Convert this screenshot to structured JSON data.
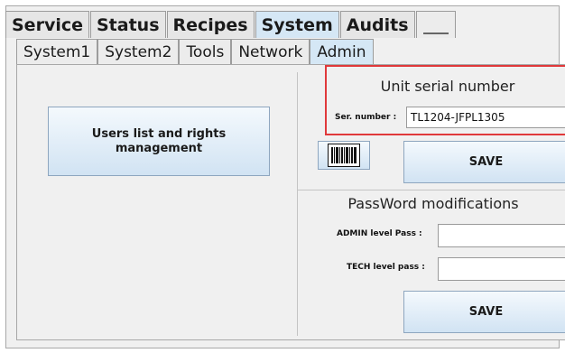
{
  "main_tabs": [
    {
      "label": "Service",
      "active": false
    },
    {
      "label": "Status",
      "active": false
    },
    {
      "label": "Recipes",
      "active": false
    },
    {
      "label": "System",
      "active": true
    },
    {
      "label": "Audits",
      "active": false
    },
    {
      "label": "",
      "active": false
    }
  ],
  "sub_tabs": [
    {
      "label": "System1",
      "active": false
    },
    {
      "label": "System2",
      "active": false
    },
    {
      "label": "Tools",
      "active": false
    },
    {
      "label": "Network",
      "active": false
    },
    {
      "label": "Admin",
      "active": true
    }
  ],
  "left_panel": {
    "users_button_label": "Users list and rights management"
  },
  "serial": {
    "title": "Unit serial number",
    "label": "Ser. number :",
    "value": "TL1204-JFPL1305",
    "highlight_color": "#e0393b",
    "scan_icon": "barcode-icon",
    "save_label": "SAVE"
  },
  "password": {
    "title": "PassWord modifications",
    "admin_label": "ADMIN level Pass :",
    "admin_value": "",
    "tech_label": "TECH level pass :",
    "tech_value": "",
    "save_label": "SAVE"
  },
  "colors": {
    "active_tab": "#d5e7f5",
    "button_top": "#f4f9fd",
    "button_bottom": "#d1e3f3"
  }
}
